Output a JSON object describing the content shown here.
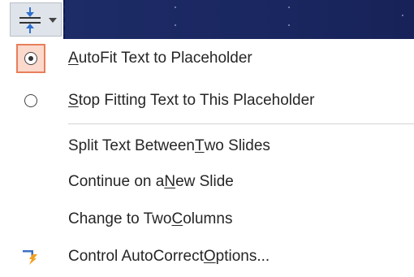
{
  "toolbar": {
    "autofit_button_icon": "autofit-options-icon",
    "dropdown_icon": "chevron-down-icon"
  },
  "menu": {
    "items": [
      {
        "key": "A",
        "pre": "",
        "post": "utoFit Text to Placeholder",
        "icon": "radio-selected",
        "checked": true
      },
      {
        "key": "S",
        "pre": "",
        "post": "top Fitting Text to This Placeholder",
        "icon": "radio-empty",
        "checked": false
      },
      {
        "key": "T",
        "pre": "Split Text Between ",
        "post": "wo Slides",
        "icon": "",
        "checked": false
      },
      {
        "key": "N",
        "pre": "Continue on a ",
        "post": "ew Slide",
        "icon": "",
        "checked": false
      },
      {
        "key": "C",
        "pre": "Change to Two ",
        "post": "olumns",
        "icon": "",
        "checked": false
      },
      {
        "key": "O",
        "pre": "Control AutoCorrect ",
        "post": "ptions...",
        "icon": "autocorrect-lightning-icon",
        "checked": false
      }
    ]
  },
  "colors": {
    "checked_bg": "#fbd9cc",
    "checked_border": "#e87e5c",
    "slide_bg": "#1b2861",
    "autocorrect_icon_blue": "#3b6fc4",
    "autocorrect_icon_orange": "#f0a020"
  }
}
